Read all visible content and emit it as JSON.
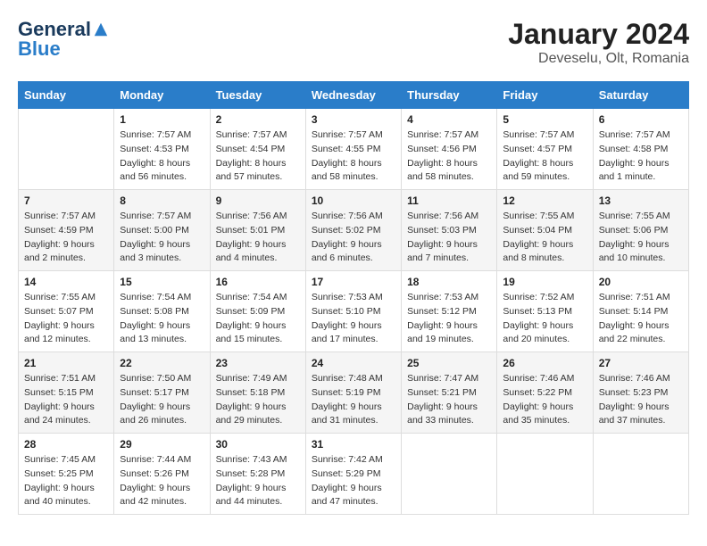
{
  "logo": {
    "general": "General",
    "blue": "Blue"
  },
  "title": "January 2024",
  "location": "Deveselu, Olt, Romania",
  "days_of_week": [
    "Sunday",
    "Monday",
    "Tuesday",
    "Wednesday",
    "Thursday",
    "Friday",
    "Saturday"
  ],
  "weeks": [
    [
      {
        "day": "",
        "sunrise": "",
        "sunset": "",
        "daylight": ""
      },
      {
        "day": "1",
        "sunrise": "Sunrise: 7:57 AM",
        "sunset": "Sunset: 4:53 PM",
        "daylight": "Daylight: 8 hours and 56 minutes."
      },
      {
        "day": "2",
        "sunrise": "Sunrise: 7:57 AM",
        "sunset": "Sunset: 4:54 PM",
        "daylight": "Daylight: 8 hours and 57 minutes."
      },
      {
        "day": "3",
        "sunrise": "Sunrise: 7:57 AM",
        "sunset": "Sunset: 4:55 PM",
        "daylight": "Daylight: 8 hours and 58 minutes."
      },
      {
        "day": "4",
        "sunrise": "Sunrise: 7:57 AM",
        "sunset": "Sunset: 4:56 PM",
        "daylight": "Daylight: 8 hours and 58 minutes."
      },
      {
        "day": "5",
        "sunrise": "Sunrise: 7:57 AM",
        "sunset": "Sunset: 4:57 PM",
        "daylight": "Daylight: 8 hours and 59 minutes."
      },
      {
        "day": "6",
        "sunrise": "Sunrise: 7:57 AM",
        "sunset": "Sunset: 4:58 PM",
        "daylight": "Daylight: 9 hours and 1 minute."
      }
    ],
    [
      {
        "day": "7",
        "sunrise": "Sunrise: 7:57 AM",
        "sunset": "Sunset: 4:59 PM",
        "daylight": "Daylight: 9 hours and 2 minutes."
      },
      {
        "day": "8",
        "sunrise": "Sunrise: 7:57 AM",
        "sunset": "Sunset: 5:00 PM",
        "daylight": "Daylight: 9 hours and 3 minutes."
      },
      {
        "day": "9",
        "sunrise": "Sunrise: 7:56 AM",
        "sunset": "Sunset: 5:01 PM",
        "daylight": "Daylight: 9 hours and 4 minutes."
      },
      {
        "day": "10",
        "sunrise": "Sunrise: 7:56 AM",
        "sunset": "Sunset: 5:02 PM",
        "daylight": "Daylight: 9 hours and 6 minutes."
      },
      {
        "day": "11",
        "sunrise": "Sunrise: 7:56 AM",
        "sunset": "Sunset: 5:03 PM",
        "daylight": "Daylight: 9 hours and 7 minutes."
      },
      {
        "day": "12",
        "sunrise": "Sunrise: 7:55 AM",
        "sunset": "Sunset: 5:04 PM",
        "daylight": "Daylight: 9 hours and 8 minutes."
      },
      {
        "day": "13",
        "sunrise": "Sunrise: 7:55 AM",
        "sunset": "Sunset: 5:06 PM",
        "daylight": "Daylight: 9 hours and 10 minutes."
      }
    ],
    [
      {
        "day": "14",
        "sunrise": "Sunrise: 7:55 AM",
        "sunset": "Sunset: 5:07 PM",
        "daylight": "Daylight: 9 hours and 12 minutes."
      },
      {
        "day": "15",
        "sunrise": "Sunrise: 7:54 AM",
        "sunset": "Sunset: 5:08 PM",
        "daylight": "Daylight: 9 hours and 13 minutes."
      },
      {
        "day": "16",
        "sunrise": "Sunrise: 7:54 AM",
        "sunset": "Sunset: 5:09 PM",
        "daylight": "Daylight: 9 hours and 15 minutes."
      },
      {
        "day": "17",
        "sunrise": "Sunrise: 7:53 AM",
        "sunset": "Sunset: 5:10 PM",
        "daylight": "Daylight: 9 hours and 17 minutes."
      },
      {
        "day": "18",
        "sunrise": "Sunrise: 7:53 AM",
        "sunset": "Sunset: 5:12 PM",
        "daylight": "Daylight: 9 hours and 19 minutes."
      },
      {
        "day": "19",
        "sunrise": "Sunrise: 7:52 AM",
        "sunset": "Sunset: 5:13 PM",
        "daylight": "Daylight: 9 hours and 20 minutes."
      },
      {
        "day": "20",
        "sunrise": "Sunrise: 7:51 AM",
        "sunset": "Sunset: 5:14 PM",
        "daylight": "Daylight: 9 hours and 22 minutes."
      }
    ],
    [
      {
        "day": "21",
        "sunrise": "Sunrise: 7:51 AM",
        "sunset": "Sunset: 5:15 PM",
        "daylight": "Daylight: 9 hours and 24 minutes."
      },
      {
        "day": "22",
        "sunrise": "Sunrise: 7:50 AM",
        "sunset": "Sunset: 5:17 PM",
        "daylight": "Daylight: 9 hours and 26 minutes."
      },
      {
        "day": "23",
        "sunrise": "Sunrise: 7:49 AM",
        "sunset": "Sunset: 5:18 PM",
        "daylight": "Daylight: 9 hours and 29 minutes."
      },
      {
        "day": "24",
        "sunrise": "Sunrise: 7:48 AM",
        "sunset": "Sunset: 5:19 PM",
        "daylight": "Daylight: 9 hours and 31 minutes."
      },
      {
        "day": "25",
        "sunrise": "Sunrise: 7:47 AM",
        "sunset": "Sunset: 5:21 PM",
        "daylight": "Daylight: 9 hours and 33 minutes."
      },
      {
        "day": "26",
        "sunrise": "Sunrise: 7:46 AM",
        "sunset": "Sunset: 5:22 PM",
        "daylight": "Daylight: 9 hours and 35 minutes."
      },
      {
        "day": "27",
        "sunrise": "Sunrise: 7:46 AM",
        "sunset": "Sunset: 5:23 PM",
        "daylight": "Daylight: 9 hours and 37 minutes."
      }
    ],
    [
      {
        "day": "28",
        "sunrise": "Sunrise: 7:45 AM",
        "sunset": "Sunset: 5:25 PM",
        "daylight": "Daylight: 9 hours and 40 minutes."
      },
      {
        "day": "29",
        "sunrise": "Sunrise: 7:44 AM",
        "sunset": "Sunset: 5:26 PM",
        "daylight": "Daylight: 9 hours and 42 minutes."
      },
      {
        "day": "30",
        "sunrise": "Sunrise: 7:43 AM",
        "sunset": "Sunset: 5:28 PM",
        "daylight": "Daylight: 9 hours and 44 minutes."
      },
      {
        "day": "31",
        "sunrise": "Sunrise: 7:42 AM",
        "sunset": "Sunset: 5:29 PM",
        "daylight": "Daylight: 9 hours and 47 minutes."
      },
      {
        "day": "",
        "sunrise": "",
        "sunset": "",
        "daylight": ""
      },
      {
        "day": "",
        "sunrise": "",
        "sunset": "",
        "daylight": ""
      },
      {
        "day": "",
        "sunrise": "",
        "sunset": "",
        "daylight": ""
      }
    ]
  ]
}
